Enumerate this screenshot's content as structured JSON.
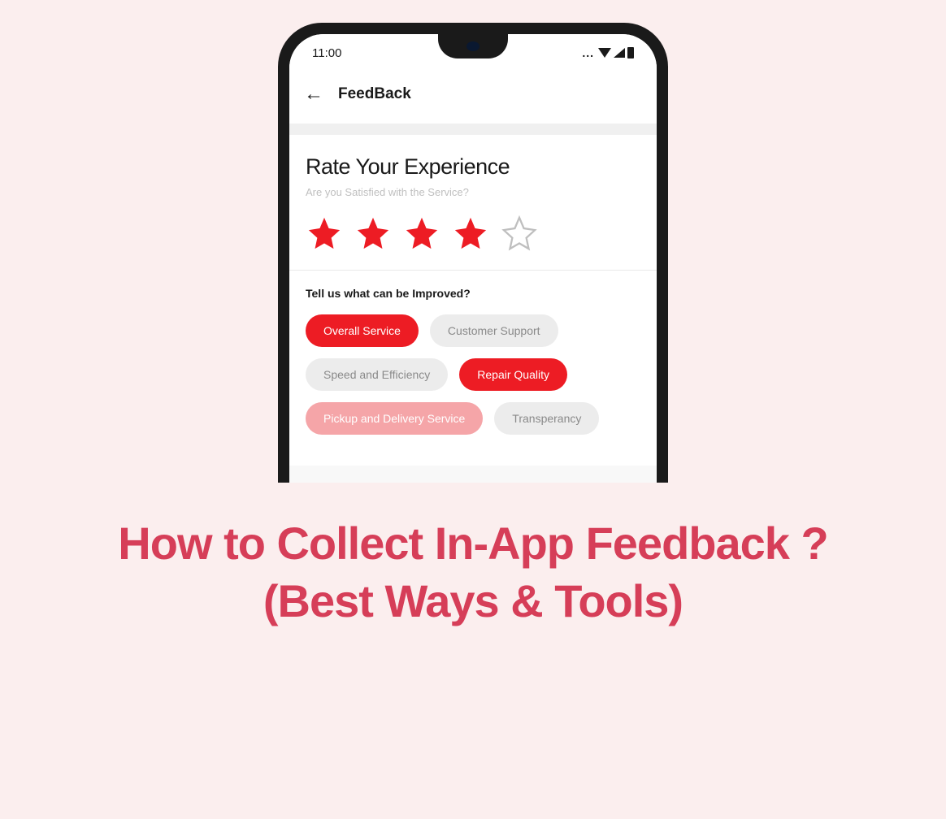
{
  "status_bar": {
    "time": "11:00",
    "dots": "..."
  },
  "app_header": {
    "title": "FeedBack"
  },
  "rate_section": {
    "title": "Rate Your Experience",
    "subtitle": "Are you Satisfied with the Service?",
    "rating": 4,
    "max_rating": 5
  },
  "improve_section": {
    "title": "Tell us what can be Improved?",
    "pills": [
      {
        "label": "Overall Service",
        "state": "selected-red"
      },
      {
        "label": "Customer Support",
        "state": "unselected"
      },
      {
        "label": "Speed and Efficiency",
        "state": "unselected"
      },
      {
        "label": "Repair Quality",
        "state": "selected-red"
      },
      {
        "label": "Pickup and Delivery Service",
        "state": "selected-pink"
      },
      {
        "label": "Transperancy",
        "state": "unselected"
      }
    ]
  },
  "article": {
    "title": "How to Collect In-App Feedback ?(Best Ways & Tools)"
  },
  "colors": {
    "accent_red": "#ed1c24",
    "accent_pink": "#d63e58",
    "background": "#fbeeee"
  }
}
